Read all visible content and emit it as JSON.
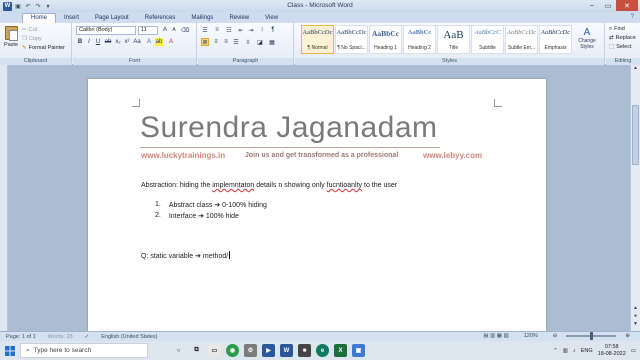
{
  "window": {
    "title": "Class - Microsoft Word"
  },
  "qat": {
    "app_icon": "W"
  },
  "tabs": [
    "Home",
    "Insert",
    "Page Layout",
    "References",
    "Mailings",
    "Review",
    "View"
  ],
  "clipboard": {
    "paste": "Paste",
    "cut": "Cut",
    "copy": "Copy",
    "format_painter": "Format Painter",
    "label": "Clipboard"
  },
  "font": {
    "name": "Calibri (Body)",
    "size": "11",
    "label": "Font"
  },
  "paragraph": {
    "label": "Paragraph"
  },
  "styles": {
    "label": "Styles",
    "items": [
      {
        "preview": "AaBbCcDc",
        "name": "¶ Normal"
      },
      {
        "preview": "AaBbCcDc",
        "name": "¶ No Spaci..."
      },
      {
        "preview": "AaBbCc",
        "name": "Heading 1"
      },
      {
        "preview": "AaBbCc",
        "name": "Heading 2"
      },
      {
        "preview": "AaB",
        "name": "Title"
      },
      {
        "preview": "AaBbCcC",
        "name": "Subtitle"
      },
      {
        "preview": "AaBbCcDc",
        "name": "Subtle Em..."
      },
      {
        "preview": "AaBbCcDc",
        "name": "Emphasis"
      }
    ],
    "change_styles": "Change Styles"
  },
  "editing": {
    "find": "Find",
    "replace": "Replace",
    "select": "Select",
    "label": "Editing"
  },
  "document": {
    "heading": "Surendra Jaganadam",
    "site_left": "www.luckytrainings.in",
    "tagline": "Join us and get transformed as a professional",
    "site_right": "www.lebyy.com",
    "para_prefix": "Abstraction: hiding the ",
    "para_word1": "implemntaton",
    "para_mid": " details n showing only ",
    "para_word2": "fucntioanlty",
    "para_suffix": " to the user",
    "list": [
      {
        "num": "1.",
        "text": "Abstract class ➔ 0-100% hiding"
      },
      {
        "num": "2.",
        "text": "Interface ➔ 100% hide"
      }
    ],
    "question": "Q: static variable ➔ method/"
  },
  "status": {
    "page": "Page: 1 of 1",
    "words": "Words: 28",
    "language": "English (United States)",
    "zoom": "120%"
  },
  "taskbar": {
    "search_placeholder": "Type here to search",
    "lang": "ENG",
    "time": "07:58",
    "date": "18-08-2022"
  }
}
